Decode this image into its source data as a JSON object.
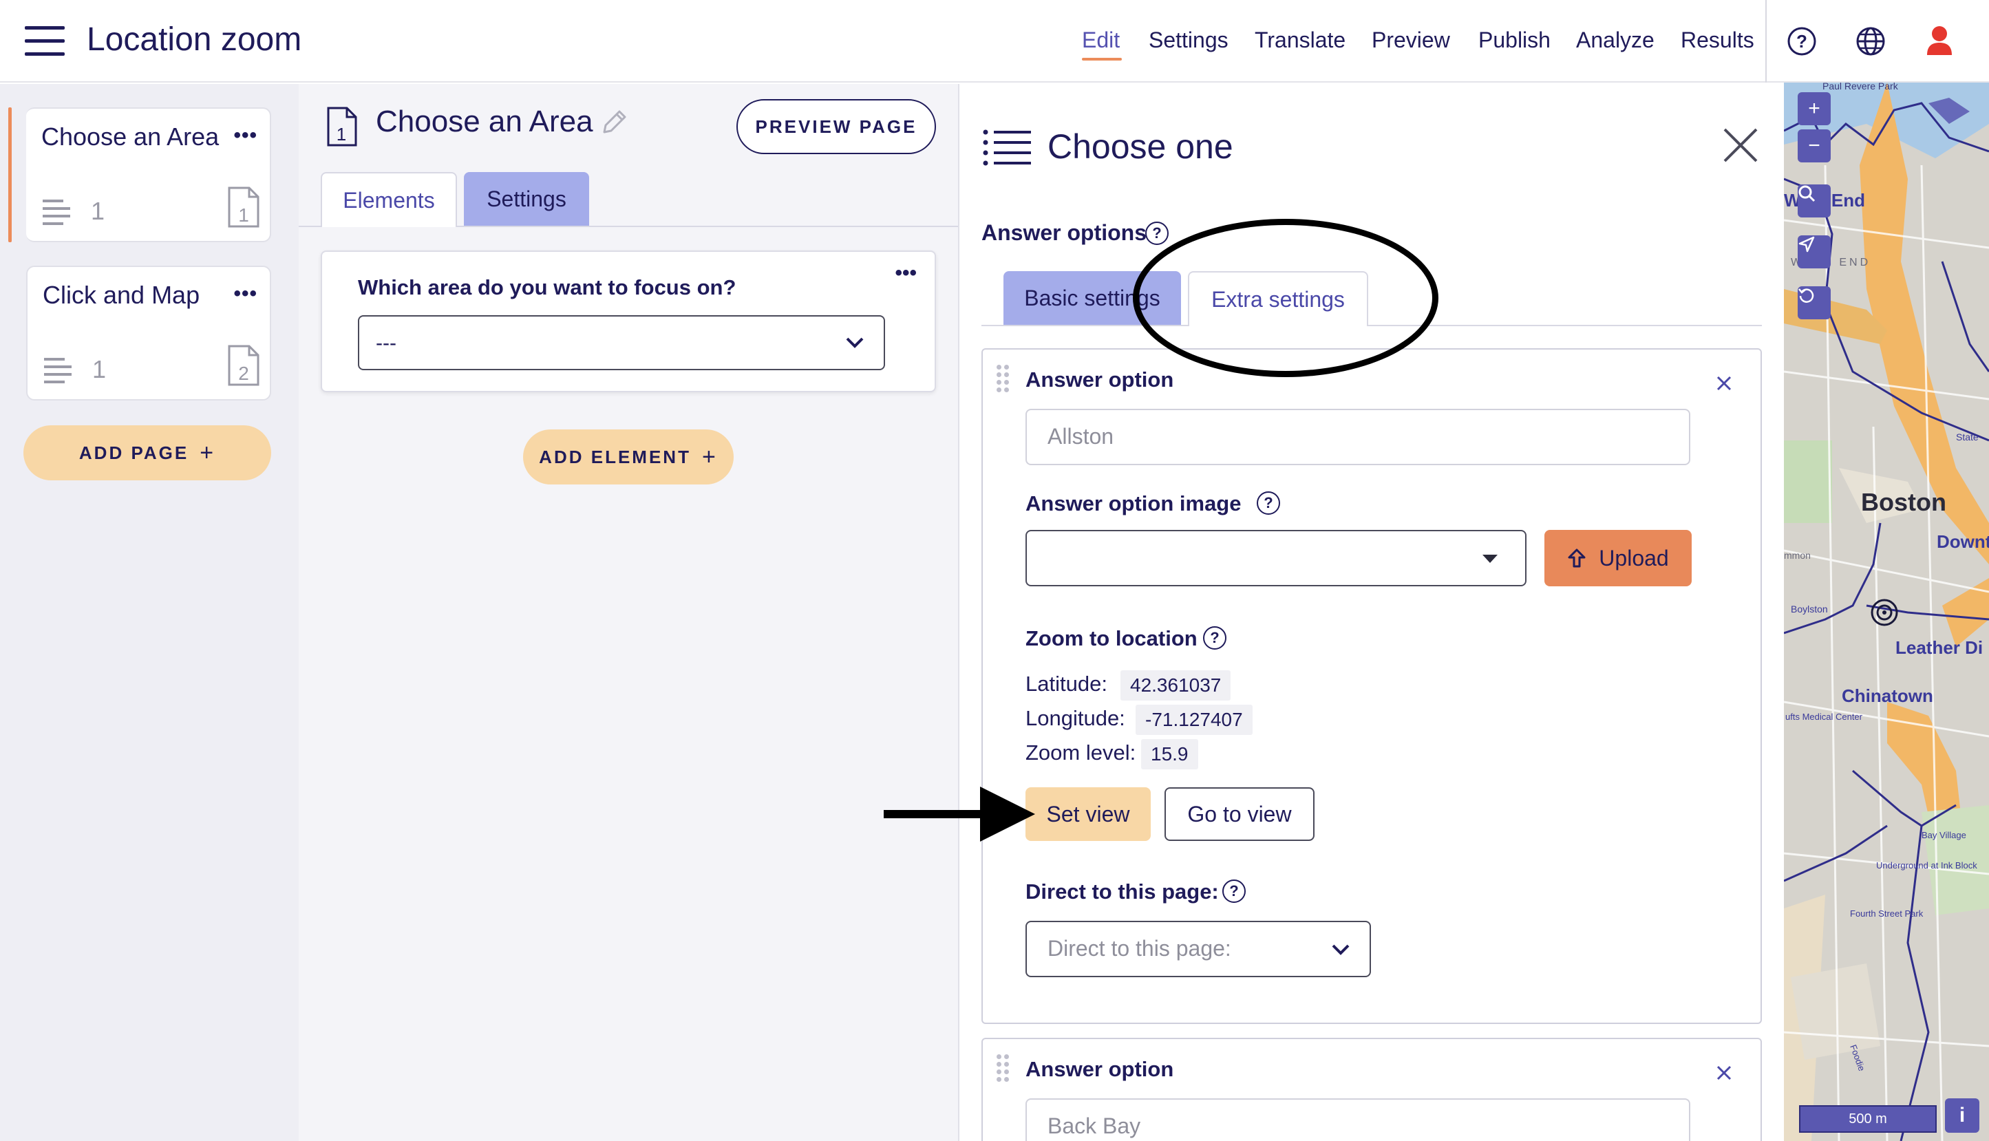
{
  "header": {
    "app_title": "Location zoom",
    "nav": [
      "Edit",
      "Settings",
      "Translate",
      "Preview",
      "Publish",
      "Analyze",
      "Results"
    ],
    "active_nav": "Edit",
    "accent_color": "#ec8c5a",
    "user_icon_color": "#e5372f"
  },
  "sidebar": {
    "pages": [
      {
        "title": "Choose an Area",
        "count": "1",
        "page_number": "1",
        "active": true
      },
      {
        "title": "Click and Map",
        "count": "1",
        "page_number": "2",
        "active": false
      }
    ],
    "add_page_label": "ADD PAGE"
  },
  "editor": {
    "page_title": "Choose an Area",
    "preview_label": "PREVIEW PAGE",
    "tabs": [
      "Elements",
      "Settings"
    ],
    "active_tab": "Settings",
    "question": {
      "label": "Which area do you want to focus on?",
      "value": "---"
    },
    "add_element_label": "ADD ELEMENT"
  },
  "panel": {
    "title": "Choose one",
    "answer_options_label": "Answer options",
    "tabs": [
      "Basic settings",
      "Extra settings"
    ],
    "active_tab": "Basic settings",
    "options": [
      {
        "label": "Answer option",
        "value": "Allston",
        "image_label": "Answer option image",
        "upload_label": "Upload",
        "zoom_label": "Zoom to location",
        "latitude_label": "Latitude:",
        "latitude": "42.361037",
        "longitude_label": "Longitude:",
        "longitude": "-71.127407",
        "zoom_level_label": "Zoom level:",
        "zoom_level": "15.9",
        "set_view_label": "Set view",
        "go_to_view_label": "Go to view",
        "direct_label": "Direct to this page:",
        "direct_placeholder": "Direct to this page:"
      },
      {
        "label": "Answer option",
        "value": "Back Bay"
      }
    ]
  },
  "map": {
    "labels": [
      "Paul Revere Park",
      "West End",
      "WEST END",
      "State",
      "Boston",
      "Downt",
      "mmon",
      "Boylston",
      "Leather Di",
      "Chinatown",
      "ufts Medical Center",
      "Bay Village",
      "Underground at Ink Block",
      "Fourth Street Park",
      "Foodie"
    ],
    "zoom_in": "+",
    "zoom_out": "−",
    "scale": "500 m",
    "info": "i"
  }
}
